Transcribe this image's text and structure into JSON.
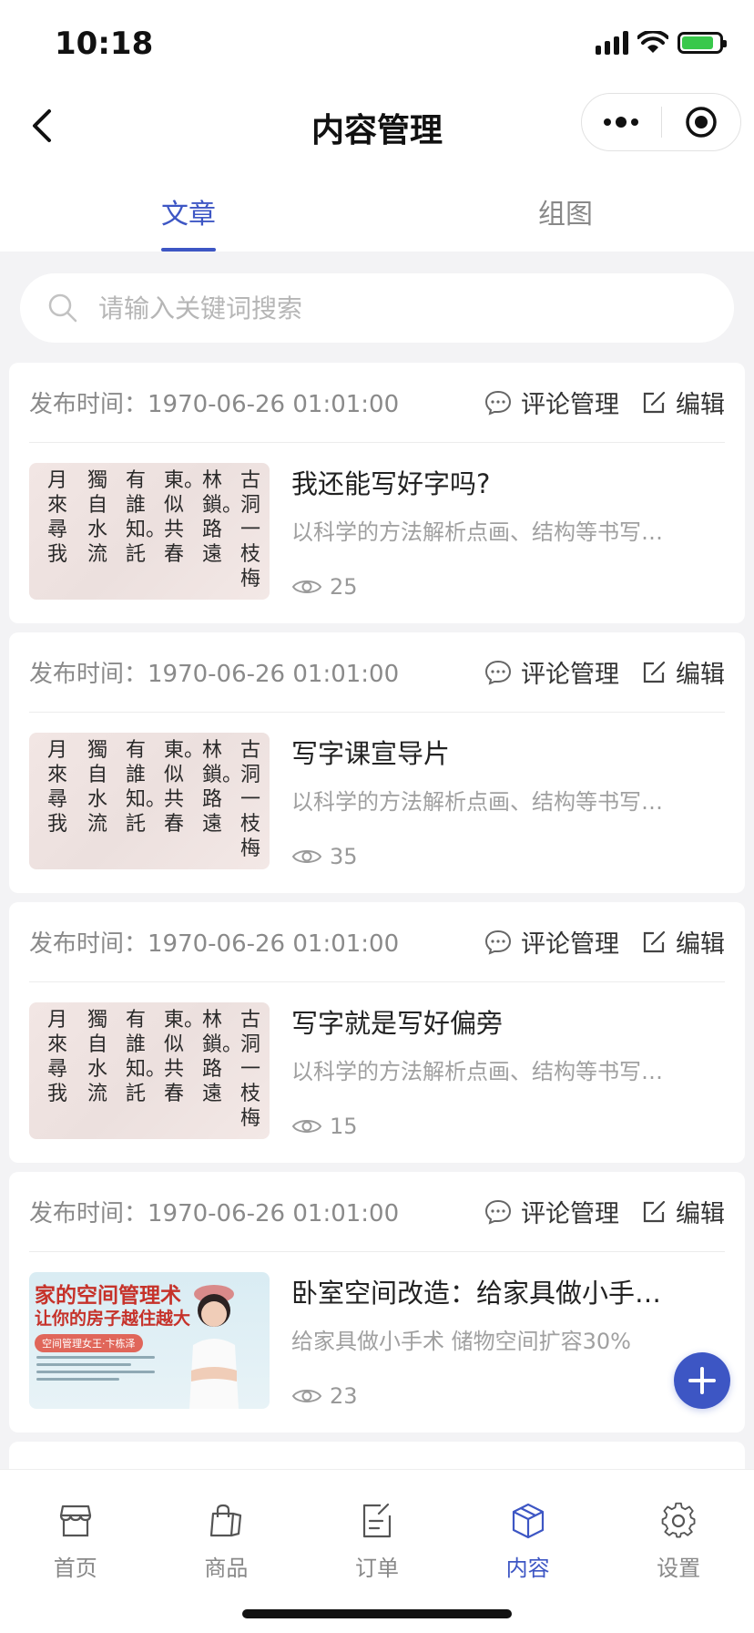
{
  "status_bar": {
    "time": "10:18"
  },
  "nav": {
    "title": "内容管理"
  },
  "tabs": [
    {
      "label": "文章",
      "active": true
    },
    {
      "label": "组图",
      "active": false
    }
  ],
  "search": {
    "placeholder": "请输入关键词搜索"
  },
  "card_actions": {
    "comment_label": "评论管理",
    "edit_label": "编辑"
  },
  "articles": [
    {
      "publish": "发布时间：1970-06-26 01:01:00",
      "title": "我还能写好字吗?",
      "desc": "以科学的方法解析点画、结构等书写要…",
      "views": "25",
      "thumb": "calligraphy"
    },
    {
      "publish": "发布时间：1970-06-26 01:01:00",
      "title": "写字课宣导片",
      "desc": "以科学的方法解析点画、结构等书写要…",
      "views": "35",
      "thumb": "calligraphy"
    },
    {
      "publish": "发布时间：1970-06-26 01:01:00",
      "title": "写字就是写好偏旁",
      "desc": "以科学的方法解析点画、结构等书写要…",
      "views": "15",
      "thumb": "calligraphy"
    },
    {
      "publish": "发布时间：1970-06-26 01:01:00",
      "title": "卧室空间改造：给家具做小手术 …",
      "desc": "给家具做小手术 储物空间扩容30%",
      "views": "23",
      "thumb": "room"
    }
  ],
  "thumbnail_text": {
    "calligraphy_columns": [
      "古洞一枝梅",
      "林鎖。路遠",
      "東。似共春",
      "有誰知。託",
      "獨自水流",
      "月來尋我"
    ],
    "room_title": "家的空间管理术",
    "room_subtitle": "让你的房子越住越大",
    "room_badge": "空间管理女王·卞栋泽"
  },
  "tabbar": [
    {
      "label": "首页",
      "icon": "store-icon",
      "active": false
    },
    {
      "label": "商品",
      "icon": "shopping-bag-icon",
      "active": false
    },
    {
      "label": "订单",
      "icon": "order-icon",
      "active": false
    },
    {
      "label": "内容",
      "icon": "cube-icon",
      "active": true
    },
    {
      "label": "设置",
      "icon": "gear-icon",
      "active": false
    }
  ],
  "colors": {
    "accent": "#3d56c4",
    "background": "#f3f3f5",
    "muted_text": "#8a8a8a"
  }
}
